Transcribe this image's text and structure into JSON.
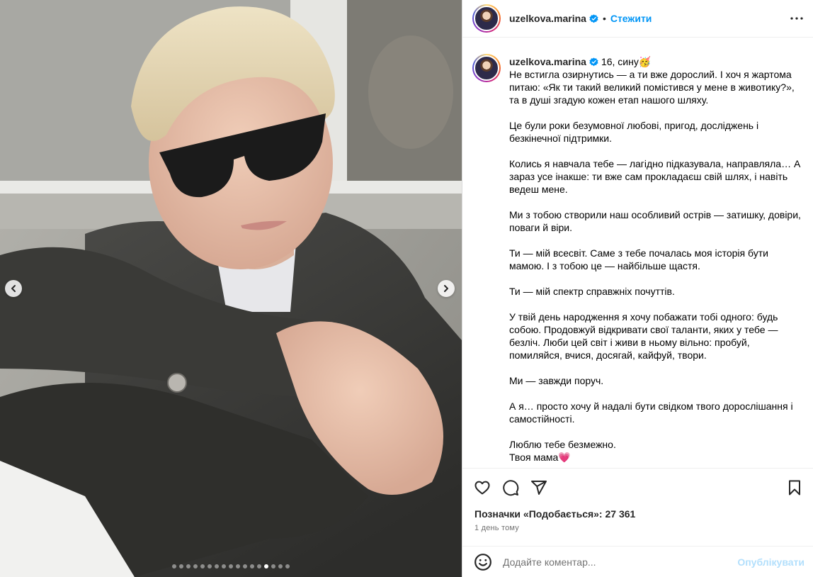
{
  "header": {
    "username": "uzelkova.marina",
    "separator": "•",
    "follow_label": "Стежити"
  },
  "caption": {
    "username": "uzelkova.marina",
    "title": "16, сину🥳",
    "paragraphs": [
      "Не встигла озирнутись — а ти вже дорослий. І хоч я жартома питаю: «Як ти такий великий помістився у мене в животику?», та в душі згадую кожен етап нашого шляху.",
      "Це були роки безумовної любові, пригод, досліджень і безкінечної підтримки.",
      "Колись я навчала тебе — лагідно підказувала, направляла… А зараз усе інакше: ти вже сам прокладаєш свій шлях, і навіть ведеш мене.",
      "Ми з тобою створили наш особливий острів — затишку, довіри, поваги й віри.",
      "Ти — мій всесвіт. Саме з тебе почалась моя історія бути мамою. І з тобою це — найбільше щастя.",
      "Ти — мій спектр справжніх почуттів.",
      "У твій день народження я хочу побажати тобі одного: будь собою. Продовжуй відкривати свої таланти, яких у тебе — безліч. Люби цей світ і живи в ньому вільно: пробуй, помиляйся, вчися, досягай, кайфуй, твори.",
      "Ми — завжди поруч.",
      "А я… просто хочу й надалі бути свідком твого дорослішання і самостійності.",
      "Люблю тебе безмежно.\nТвоя мама💗"
    ]
  },
  "likes": "Позначки «Подобається»: 27 361",
  "time": "1 день тому",
  "comment": {
    "placeholder": "Додайте коментар...",
    "post_label": "Опублікувати"
  },
  "carousel": {
    "slide_count": 17,
    "active_index": 13
  },
  "icons": {
    "like": "heart-icon",
    "comment": "comment-bubble-icon",
    "share": "paper-plane-icon",
    "save": "bookmark-icon",
    "more": "more-horizontal-icon",
    "emoji": "smiley-icon",
    "verified": "verified-badge-icon"
  },
  "colors": {
    "accent": "#0095f6",
    "post_disabled": "#b2dffc",
    "verified": "#0095f6"
  }
}
